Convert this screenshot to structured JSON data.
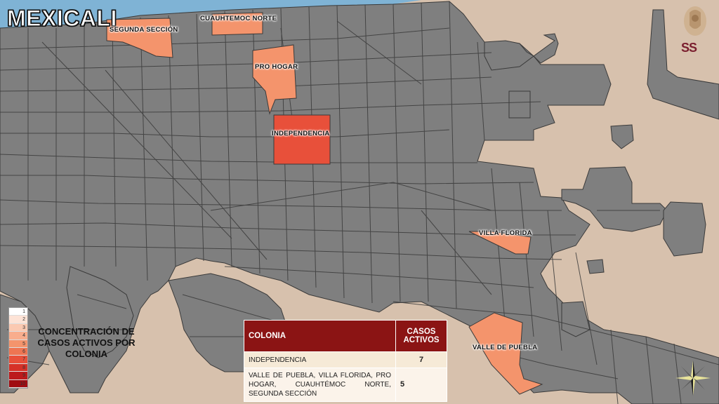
{
  "map": {
    "title": "MEXICALI",
    "colors": {
      "background": "#d7c1ad",
      "water": "#7fb3d5",
      "block": "#7f7f7f",
      "border": "#3a3a3a",
      "level_5": "#f4946c",
      "level_7": "#e8503a"
    },
    "highlighted_colonias": [
      {
        "name": "SEGUNDA SECCIÓN",
        "cases": 5
      },
      {
        "name": "CUAUHTEMOC NORTE",
        "cases": 5
      },
      {
        "name": "PRO HOGAR",
        "cases": 5
      },
      {
        "name": "INDEPENDENCIA",
        "cases": 7
      },
      {
        "name": "VILLA FLORIDA",
        "cases": 5
      },
      {
        "name": "VALLE DE PUEBLA",
        "cases": 5
      }
    ]
  },
  "legend": {
    "title": "CONCENTRACIÓN DE CASOS ACTIVOS POR COLONIA",
    "levels": [
      "1",
      "2",
      "3",
      "4",
      "5",
      "6",
      "7",
      "8",
      "9",
      "10"
    ],
    "colors": [
      "#ffffff",
      "#fde3d6",
      "#fbc9b1",
      "#f8ad8d",
      "#f4946c",
      "#ee7552",
      "#e8503a",
      "#d63127",
      "#bc1a1c",
      "#a00c12"
    ]
  },
  "table": {
    "headers": {
      "colonia": "COLONIA",
      "casos": "CASOS ACTIVOS"
    },
    "rows": [
      {
        "colonia": "INDEPENDENCIA",
        "casos": "7"
      },
      {
        "colonia": "VALLE DE PUEBLA, VILLA FLORIDA, PRO HOGAR, CUAUHTÉMOC NORTE, SEGUNDA SECCIÓN",
        "casos": "5"
      }
    ]
  },
  "logo": {
    "text": "SS",
    "icon": "shield-emblem-icon"
  },
  "compass_icon": "compass-rose-icon"
}
